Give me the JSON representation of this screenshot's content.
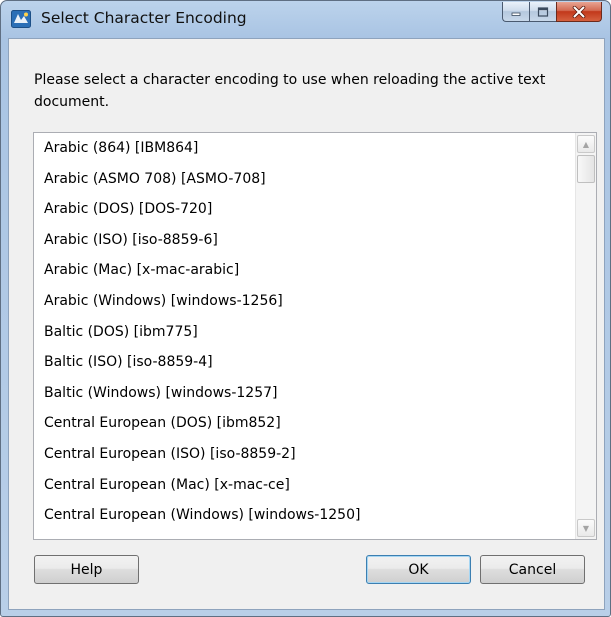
{
  "window": {
    "title": "Select Character Encoding"
  },
  "icons": {
    "app": "app-icon",
    "minimize": "minimize-icon",
    "maximize": "maximize-icon",
    "close": "close-icon",
    "scroll_up": "scroll-up-arrow-icon",
    "scroll_down": "scroll-down-arrow-icon"
  },
  "colors": {
    "titlebar": "#b9cfe8",
    "close_button": "#c2381b",
    "client_background": "#f0f0f0",
    "default_button_border": "#3c7fb1"
  },
  "prompt": "Please select a character encoding to use when reloading the active text document.",
  "encodings": [
    "Arabic (864) [IBM864]",
    "Arabic (ASMO 708) [ASMO-708]",
    "Arabic (DOS) [DOS-720]",
    "Arabic (ISO) [iso-8859-6]",
    "Arabic (Mac) [x-mac-arabic]",
    "Arabic (Windows) [windows-1256]",
    "Baltic (DOS) [ibm775]",
    "Baltic (ISO) [iso-8859-4]",
    "Baltic (Windows) [windows-1257]",
    "Central European (DOS) [ibm852]",
    "Central European (ISO) [iso-8859-2]",
    "Central European (Mac) [x-mac-ce]",
    "Central European (Windows) [windows-1250]"
  ],
  "buttons": {
    "help": "Help",
    "ok": "OK",
    "cancel": "Cancel"
  }
}
